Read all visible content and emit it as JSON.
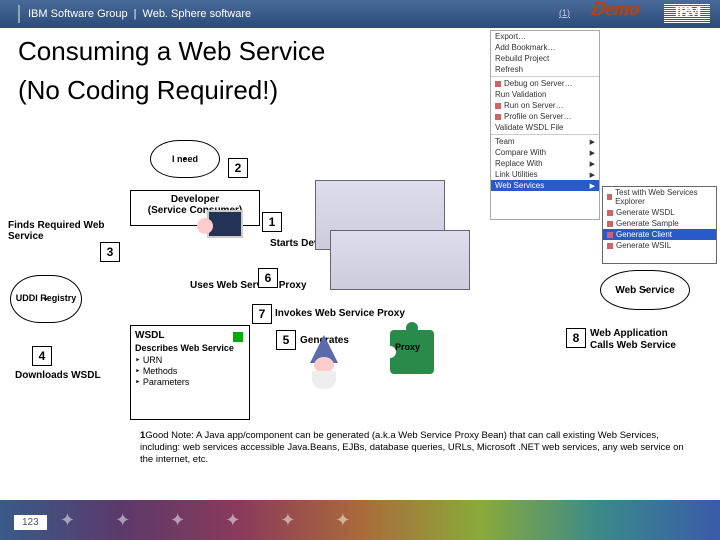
{
  "topbar": {
    "group": "IBM Software Group",
    "product": "Web. Sphere software",
    "link": "(1)"
  },
  "demo": "Demo",
  "title_l1": "Consuming a Web Service",
  "title_l2": "(No Coding Required!)",
  "think": "I need",
  "developer_l1": "Developer",
  "developer_l2": "(Service Consumer)",
  "webapp": "Web Application",
  "finds": "Finds Required Web Service",
  "starts": "Starts Developing",
  "uses_proxy": "Uses Web Service Proxy",
  "invokes": "Invokes Web Service Proxy",
  "generates": "Generates",
  "proxy": "Proxy",
  "uddi": "UDDI Registry",
  "webservice": "Web Service",
  "downloads": "Downloads WSDL",
  "step8_l1": "Web Application",
  "step8_l2": "Calls Web Service",
  "wsdl": {
    "title": "WSDL",
    "desc": "Describes Web Service",
    "items": [
      "URN",
      "Methods",
      "Parameters"
    ]
  },
  "steps": {
    "1": "1",
    "2": "2",
    "3": "3",
    "4": "4",
    "5": "5",
    "6": "6",
    "7": "7",
    "8": "8"
  },
  "footnote_num": "1",
  "footnote": "Good Note: A Java app/component can be generated (a.k.a Web Service Proxy Bean) that can call existing Web Services, including: web services accessible Java.Beans, EJBs, database queries, URLs, Microsoft .NET web services, any web service on the internet, etc.",
  "page": "123",
  "menu": {
    "items": [
      "Export…",
      "Add Bookmark…",
      "Rebuild Project",
      "Refresh",
      "Debug on Server…",
      "Run Validation",
      "Run on Server…",
      "Profile on Server…",
      "Validate WSDL File",
      "Team",
      "Compare With",
      "Replace With",
      "Link Utilities"
    ],
    "hl": "Web Services",
    "sub": [
      "Test with Web Services Explorer",
      "Generate WSDL",
      "Generate Sample",
      "Generate Client",
      "Generate WSIL"
    ],
    "sub_hl": "Generate Client"
  }
}
